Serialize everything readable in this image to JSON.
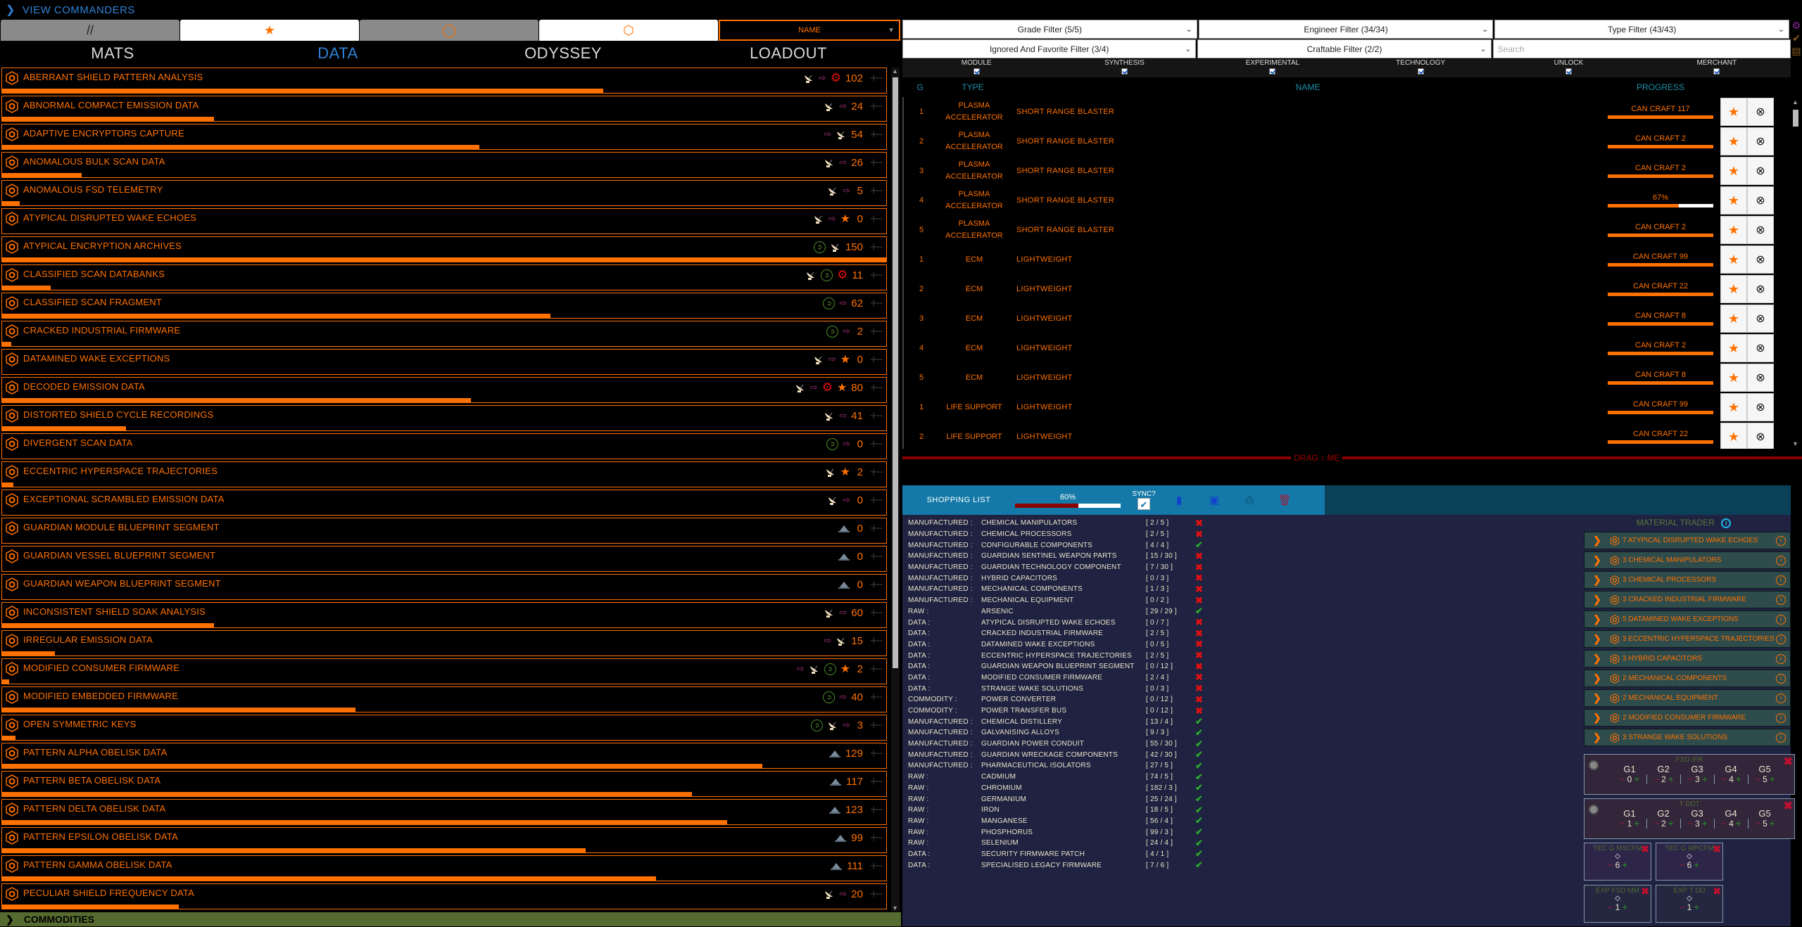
{
  "header": {
    "view_commanders": "VIEW COMMANDERS"
  },
  "toolbar": {
    "buttons": [
      {
        "name": "hide-zero-button",
        "glyph": "//"
      },
      {
        "name": "favorites-button",
        "glyph": "★"
      },
      {
        "name": "engineer-button",
        "glyph": "◯"
      },
      {
        "name": "cargo-button",
        "glyph": "⬡"
      }
    ],
    "sort_value": "NAME"
  },
  "tabs": [
    "MATS",
    "DATA",
    "ODYSSEY",
    "LOADOUT"
  ],
  "active_tab": "DATA",
  "materials": [
    {
      "name": "ABERRANT SHIELD PATTERN ANALYSIS",
      "count": "102",
      "icons": [
        "dish",
        "arrow",
        "gear"
      ],
      "fill": 0.68
    },
    {
      "name": "ABNORMAL COMPACT EMISSION DATA",
      "count": "24",
      "icons": [
        "dish",
        "arrow"
      ],
      "fill": 0.24
    },
    {
      "name": "ADAPTIVE ENCRYPTORS CAPTURE",
      "count": "54",
      "icons": [
        "arrow",
        "dish"
      ],
      "fill": 0.54
    },
    {
      "name": "ANOMALOUS BULK SCAN DATA",
      "count": "26",
      "icons": [
        "dish",
        "arrow"
      ],
      "fill": 0.09
    },
    {
      "name": "ANOMALOUS FSD TELEMETRY",
      "count": "5",
      "icons": [
        "dish",
        "arrow"
      ],
      "fill": 0.02
    },
    {
      "name": "ATYPICAL DISRUPTED WAKE ECHOES",
      "count": "0",
      "icons": [
        "dish",
        "arrow",
        "star"
      ],
      "fill": 0.0
    },
    {
      "name": "ATYPICAL ENCRYPTION ARCHIVES",
      "count": "150",
      "icons": [
        "swirl",
        "dish"
      ],
      "fill": 1.0
    },
    {
      "name": "CLASSIFIED SCAN DATABANKS",
      "count": "11",
      "icons": [
        "dish",
        "swirl",
        "gear"
      ],
      "fill": 0.055
    },
    {
      "name": "CLASSIFIED SCAN FRAGMENT",
      "count": "62",
      "icons": [
        "swirl",
        "arrow"
      ],
      "fill": 0.62
    },
    {
      "name": "CRACKED INDUSTRIAL FIRMWARE",
      "count": "2",
      "icons": [
        "swirl",
        "arrow"
      ],
      "fill": 0.01
    },
    {
      "name": "DATAMINED WAKE EXCEPTIONS",
      "count": "0",
      "icons": [
        "dish",
        "arrow",
        "star"
      ],
      "fill": 0.0
    },
    {
      "name": "DECODED EMISSION DATA",
      "count": "80",
      "icons": [
        "dish",
        "arrow",
        "gear",
        "star"
      ],
      "fill": 0.53
    },
    {
      "name": "DISTORTED SHIELD CYCLE RECORDINGS",
      "count": "41",
      "icons": [
        "dish",
        "arrow"
      ],
      "fill": 0.14
    },
    {
      "name": "DIVERGENT SCAN DATA",
      "count": "0",
      "icons": [
        "swirl",
        "arrow"
      ],
      "fill": 0.0
    },
    {
      "name": "ECCENTRIC HYPERSPACE TRAJECTORIES",
      "count": "2",
      "icons": [
        "dish",
        "star"
      ],
      "fill": 0.013
    },
    {
      "name": "EXCEPTIONAL SCRAMBLED EMISSION DATA",
      "count": "0",
      "icons": [
        "dish",
        "arrow"
      ],
      "fill": 0.0
    },
    {
      "name": "GUARDIAN MODULE BLUEPRINT SEGMENT",
      "count": "0",
      "icons": [
        "pile"
      ],
      "fill": 0.0
    },
    {
      "name": "GUARDIAN VESSEL BLUEPRINT SEGMENT",
      "count": "0",
      "icons": [
        "pile"
      ],
      "fill": 0.0
    },
    {
      "name": "GUARDIAN WEAPON BLUEPRINT SEGMENT",
      "count": "0",
      "icons": [
        "pile"
      ],
      "fill": 0.0
    },
    {
      "name": "INCONSISTENT SHIELD SOAK ANALYSIS",
      "count": "60",
      "icons": [
        "dish",
        "arrow"
      ],
      "fill": 0.24
    },
    {
      "name": "IRREGULAR EMISSION DATA",
      "count": "15",
      "icons": [
        "arrow",
        "dish"
      ],
      "fill": 0.06
    },
    {
      "name": "MODIFIED CONSUMER FIRMWARE",
      "count": "2",
      "icons": [
        "arrow",
        "dish",
        "swirl",
        "star"
      ],
      "fill": 0.008
    },
    {
      "name": "MODIFIED EMBEDDED FIRMWARE",
      "count": "40",
      "icons": [
        "swirl",
        "arrow"
      ],
      "fill": 0.4
    },
    {
      "name": "OPEN SYMMETRIC KEYS",
      "count": "3",
      "icons": [
        "swirl",
        "dish",
        "arrow"
      ],
      "fill": 0.015
    },
    {
      "name": "PATTERN ALPHA OBELISK DATA",
      "count": "129",
      "icons": [
        "pile"
      ],
      "fill": 0.86
    },
    {
      "name": "PATTERN BETA OBELISK DATA",
      "count": "117",
      "icons": [
        "pile"
      ],
      "fill": 0.78
    },
    {
      "name": "PATTERN DELTA OBELISK DATA",
      "count": "123",
      "icons": [
        "pile"
      ],
      "fill": 0.82
    },
    {
      "name": "PATTERN EPSILON OBELISK DATA",
      "count": "99",
      "icons": [
        "pile"
      ],
      "fill": 0.66
    },
    {
      "name": "PATTERN GAMMA OBELISK DATA",
      "count": "111",
      "icons": [
        "pile"
      ],
      "fill": 0.74
    },
    {
      "name": "PECULIAR SHIELD FREQUENCY DATA",
      "count": "20",
      "icons": [
        "dish",
        "arrow"
      ],
      "fill": 0.2
    }
  ],
  "commodities_label": "COMMODITIES",
  "filters": {
    "grade": "Grade Filter (5/5)",
    "engineer": "Engineer Filter (34/34)",
    "type": "Type Filter (43/43)",
    "ignored": "Ignored And Favorite Filter (3/4)",
    "craftable": "Craftable Filter (2/2)",
    "search_placeholder": "Search"
  },
  "type_checkboxes": [
    "MODULE",
    "SYNTHESIS",
    "EXPERIMENTAL",
    "TECHNOLOGY",
    "UNLOCK",
    "MERCHANT"
  ],
  "blueprint_headers": {
    "g": "G",
    "type": "TYPE",
    "name": "NAME",
    "progress": "PROGRESS"
  },
  "blueprints": [
    {
      "g": "1",
      "type": "PLASMA ACCELERATOR",
      "name": "SHORT RANGE BLASTER",
      "progress": "CAN CRAFT 117",
      "fill": 1.0
    },
    {
      "g": "2",
      "type": "PLASMA ACCELERATOR",
      "name": "SHORT RANGE BLASTER",
      "progress": "CAN CRAFT 2",
      "fill": 1.0
    },
    {
      "g": "3",
      "type": "PLASMA ACCELERATOR",
      "name": "SHORT RANGE BLASTER",
      "progress": "CAN CRAFT 2",
      "fill": 1.0
    },
    {
      "g": "4",
      "type": "PLASMA ACCELERATOR",
      "name": "SHORT RANGE BLASTER",
      "progress": "67%",
      "fill": 0.67
    },
    {
      "g": "5",
      "type": "PLASMA ACCELERATOR",
      "name": "SHORT RANGE BLASTER",
      "progress": "CAN CRAFT 2",
      "fill": 1.0
    },
    {
      "g": "1",
      "type": "ECM",
      "name": "LIGHTWEIGHT",
      "progress": "CAN CRAFT 99",
      "fill": 1.0
    },
    {
      "g": "2",
      "type": "ECM",
      "name": "LIGHTWEIGHT",
      "progress": "CAN CRAFT 22",
      "fill": 1.0
    },
    {
      "g": "3",
      "type": "ECM",
      "name": "LIGHTWEIGHT",
      "progress": "CAN CRAFT 8",
      "fill": 1.0
    },
    {
      "g": "4",
      "type": "ECM",
      "name": "LIGHTWEIGHT",
      "progress": "CAN CRAFT 2",
      "fill": 1.0
    },
    {
      "g": "5",
      "type": "ECM",
      "name": "LIGHTWEIGHT",
      "progress": "CAN CRAFT 8",
      "fill": 1.0
    },
    {
      "g": "1",
      "type": "LIFE SUPPORT",
      "name": "LIGHTWEIGHT",
      "progress": "CAN CRAFT 99",
      "fill": 1.0
    },
    {
      "g": "2",
      "type": "LIFE SUPPORT",
      "name": "LIGHTWEIGHT",
      "progress": "CAN CRAFT 22",
      "fill": 1.0
    }
  ],
  "drag_label": "DRAG ↕ ME",
  "shopping": {
    "title": "SHOPPING LIST",
    "percent": "60%",
    "fill": 0.6,
    "sync_label": "SYNC?",
    "sync_checked": "✔",
    "items": [
      {
        "cat": "MANUFACTURED :",
        "name": "CHEMICAL MANIPULATORS",
        "count": "[ 2 / 5 ]",
        "ok": false
      },
      {
        "cat": "MANUFACTURED :",
        "name": "CHEMICAL PROCESSORS",
        "count": "[ 2 / 5 ]",
        "ok": false
      },
      {
        "cat": "MANUFACTURED :",
        "name": "CONFIGURABLE COMPONENTS",
        "count": "[ 4 / 4 ]",
        "ok": true
      },
      {
        "cat": "MANUFACTURED :",
        "name": "GUARDIAN SENTINEL WEAPON PARTS",
        "count": "[ 15 / 30 ]",
        "ok": false
      },
      {
        "cat": "MANUFACTURED :",
        "name": "GUARDIAN TECHNOLOGY COMPONENT",
        "count": "[ 7 / 30 ]",
        "ok": false
      },
      {
        "cat": "MANUFACTURED :",
        "name": "HYBRID CAPACITORS",
        "count": "[ 0 / 3 ]",
        "ok": false
      },
      {
        "cat": "MANUFACTURED :",
        "name": "MECHANICAL COMPONENTS",
        "count": "[ 1 / 3 ]",
        "ok": false
      },
      {
        "cat": "MANUFACTURED :",
        "name": "MECHANICAL EQUIPMENT",
        "count": "[ 0 / 2 ]",
        "ok": false
      },
      {
        "cat": "RAW :",
        "name": "ARSENIC",
        "count": "[ 29 / 29 ]",
        "ok": true
      },
      {
        "cat": "DATA :",
        "name": "ATYPICAL DISRUPTED WAKE ECHOES",
        "count": "[ 0 / 7 ]",
        "ok": false
      },
      {
        "cat": "DATA :",
        "name": "CRACKED INDUSTRIAL FIRMWARE",
        "count": "[ 2 / 5 ]",
        "ok": false
      },
      {
        "cat": "DATA :",
        "name": "DATAMINED WAKE EXCEPTIONS",
        "count": "[ 0 / 5 ]",
        "ok": false
      },
      {
        "cat": "DATA :",
        "name": "ECCENTRIC HYPERSPACE TRAJECTORIES",
        "count": "[ 2 / 5 ]",
        "ok": false
      },
      {
        "cat": "DATA :",
        "name": "GUARDIAN WEAPON BLUEPRINT SEGMENT",
        "count": "[ 0 / 12 ]",
        "ok": false
      },
      {
        "cat": "DATA :",
        "name": "MODIFIED CONSUMER FIRMWARE",
        "count": "[ 2 / 4 ]",
        "ok": false
      },
      {
        "cat": "DATA :",
        "name": "STRANGE WAKE SOLUTIONS",
        "count": "[ 0 / 3 ]",
        "ok": false
      },
      {
        "cat": "COMMODITY :",
        "name": "POWER CONVERTER",
        "count": "[ 0 / 12 ]",
        "ok": false
      },
      {
        "cat": "COMMODITY :",
        "name": "POWER TRANSFER BUS",
        "count": "[ 0 / 12 ]",
        "ok": false
      },
      {
        "cat": "MANUFACTURED :",
        "name": "CHEMICAL DISTILLERY",
        "count": "[ 13 / 4 ]",
        "ok": true
      },
      {
        "cat": "MANUFACTURED :",
        "name": "GALVANISING ALLOYS",
        "count": "[ 9 / 3 ]",
        "ok": true
      },
      {
        "cat": "MANUFACTURED :",
        "name": "GUARDIAN POWER CONDUIT",
        "count": "[ 55 / 30 ]",
        "ok": true
      },
      {
        "cat": "MANUFACTURED :",
        "name": "GUARDIAN WRECKAGE COMPONENTS",
        "count": "[ 42 / 30 ]",
        "ok": true
      },
      {
        "cat": "MANUFACTURED :",
        "name": "PHARMACEUTICAL ISOLATORS",
        "count": "[ 27 / 5 ]",
        "ok": true
      },
      {
        "cat": "RAW :",
        "name": "CADMIUM",
        "count": "[ 74 / 5 ]",
        "ok": true
      },
      {
        "cat": "RAW :",
        "name": "CHROMIUM",
        "count": "[ 182 / 3 ]",
        "ok": true
      },
      {
        "cat": "RAW :",
        "name": "GERMANIUM",
        "count": "[ 25 / 24 ]",
        "ok": true
      },
      {
        "cat": "RAW :",
        "name": "IRON",
        "count": "[ 18 / 5 ]",
        "ok": true
      },
      {
        "cat": "RAW :",
        "name": "MANGANESE",
        "count": "[ 56 / 4 ]",
        "ok": true
      },
      {
        "cat": "RAW :",
        "name": "PHOSPHORUS",
        "count": "[ 99 / 3 ]",
        "ok": true
      },
      {
        "cat": "RAW :",
        "name": "SELENIUM",
        "count": "[ 24 / 4 ]",
        "ok": true
      },
      {
        "cat": "DATA :",
        "name": "SECURITY FIRMWARE PATCH",
        "count": "[ 4 / 1 ]",
        "ok": true
      },
      {
        "cat": "DATA :",
        "name": "SPECIALISED LEGACY FIRMWARE",
        "count": "[ 7 / 6 ]",
        "ok": true
      }
    ]
  },
  "trader": {
    "title": "MATERIAL TRADER",
    "items": [
      "7 ATYPICAL DISRUPTED WAKE ECHOES",
      "3 CHEMICAL MANIPULATORS",
      "3 CHEMICAL PROCESSORS",
      "3 CRACKED INDUSTRIAL FIRMWARE",
      "5 DATAMINED WAKE EXCEPTIONS",
      "3 ECCENTRIC HYPERSPACE TRAJECTORIES",
      "3 HYBRID CAPACITORS",
      "2 MECHANICAL COMPONENTS",
      "2 MECHANICAL EQUIPMENT",
      "2 MODIFIED CONSUMER FIRMWARE",
      "3 STRANGE WAKE SOLUTIONS"
    ]
  },
  "grade_cards": [
    {
      "title": "FSD IFR",
      "grades": [
        "G1",
        "G2",
        "G3",
        "G4",
        "G5"
      ],
      "values": [
        "0",
        "2",
        "3",
        "4",
        "5"
      ]
    },
    {
      "title": "T DDT",
      "grades": [
        "G1",
        "G2",
        "G3",
        "G4",
        "G5"
      ],
      "values": [
        "1",
        "2",
        "3",
        "4",
        "5"
      ]
    }
  ],
  "single_cards": [
    {
      "title": "TEC G MSCFM",
      "value": "6"
    },
    {
      "title": "TEC G MPCFM",
      "value": "6"
    },
    {
      "title": "EXP FSD MM",
      "value": "1"
    },
    {
      "title": "EXP T DD",
      "value": "1"
    }
  ]
}
